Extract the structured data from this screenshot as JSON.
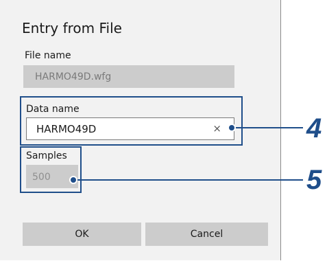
{
  "dialog": {
    "title": "Entry from File",
    "file_name": {
      "label": "File name",
      "value": "HARMO49D.wfg"
    },
    "data_name": {
      "label": "Data name",
      "value": "HARMO49D",
      "clear_glyph": "×"
    },
    "samples": {
      "label": "Samples",
      "value": "500"
    },
    "ok_label": "OK",
    "cancel_label": "Cancel"
  },
  "callouts": {
    "data_name_number": "4",
    "samples_number": "5",
    "color": "#1f4e8a"
  }
}
